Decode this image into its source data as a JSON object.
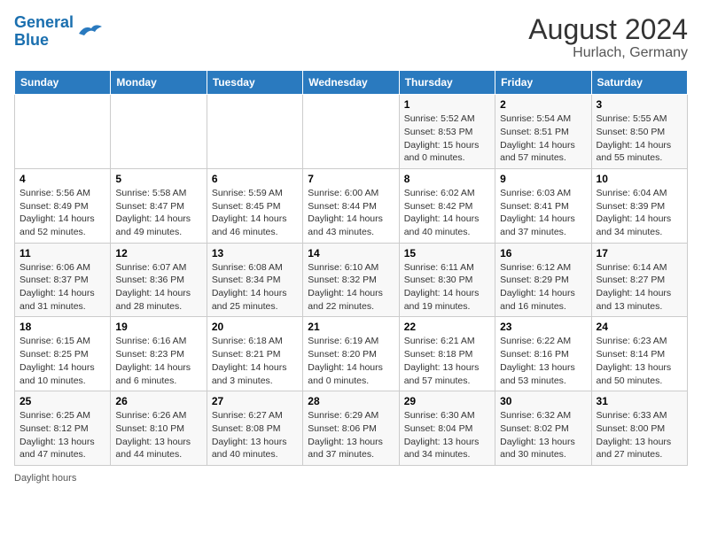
{
  "header": {
    "logo_line1": "General",
    "logo_line2": "Blue",
    "title": "August 2024",
    "subtitle": "Hurlach, Germany"
  },
  "days_of_week": [
    "Sunday",
    "Monday",
    "Tuesday",
    "Wednesday",
    "Thursday",
    "Friday",
    "Saturday"
  ],
  "weeks": [
    [
      {
        "num": "",
        "info": ""
      },
      {
        "num": "",
        "info": ""
      },
      {
        "num": "",
        "info": ""
      },
      {
        "num": "",
        "info": ""
      },
      {
        "num": "1",
        "info": "Sunrise: 5:52 AM\nSunset: 8:53 PM\nDaylight: 15 hours and 0 minutes."
      },
      {
        "num": "2",
        "info": "Sunrise: 5:54 AM\nSunset: 8:51 PM\nDaylight: 14 hours and 57 minutes."
      },
      {
        "num": "3",
        "info": "Sunrise: 5:55 AM\nSunset: 8:50 PM\nDaylight: 14 hours and 55 minutes."
      }
    ],
    [
      {
        "num": "4",
        "info": "Sunrise: 5:56 AM\nSunset: 8:49 PM\nDaylight: 14 hours and 52 minutes."
      },
      {
        "num": "5",
        "info": "Sunrise: 5:58 AM\nSunset: 8:47 PM\nDaylight: 14 hours and 49 minutes."
      },
      {
        "num": "6",
        "info": "Sunrise: 5:59 AM\nSunset: 8:45 PM\nDaylight: 14 hours and 46 minutes."
      },
      {
        "num": "7",
        "info": "Sunrise: 6:00 AM\nSunset: 8:44 PM\nDaylight: 14 hours and 43 minutes."
      },
      {
        "num": "8",
        "info": "Sunrise: 6:02 AM\nSunset: 8:42 PM\nDaylight: 14 hours and 40 minutes."
      },
      {
        "num": "9",
        "info": "Sunrise: 6:03 AM\nSunset: 8:41 PM\nDaylight: 14 hours and 37 minutes."
      },
      {
        "num": "10",
        "info": "Sunrise: 6:04 AM\nSunset: 8:39 PM\nDaylight: 14 hours and 34 minutes."
      }
    ],
    [
      {
        "num": "11",
        "info": "Sunrise: 6:06 AM\nSunset: 8:37 PM\nDaylight: 14 hours and 31 minutes."
      },
      {
        "num": "12",
        "info": "Sunrise: 6:07 AM\nSunset: 8:36 PM\nDaylight: 14 hours and 28 minutes."
      },
      {
        "num": "13",
        "info": "Sunrise: 6:08 AM\nSunset: 8:34 PM\nDaylight: 14 hours and 25 minutes."
      },
      {
        "num": "14",
        "info": "Sunrise: 6:10 AM\nSunset: 8:32 PM\nDaylight: 14 hours and 22 minutes."
      },
      {
        "num": "15",
        "info": "Sunrise: 6:11 AM\nSunset: 8:30 PM\nDaylight: 14 hours and 19 minutes."
      },
      {
        "num": "16",
        "info": "Sunrise: 6:12 AM\nSunset: 8:29 PM\nDaylight: 14 hours and 16 minutes."
      },
      {
        "num": "17",
        "info": "Sunrise: 6:14 AM\nSunset: 8:27 PM\nDaylight: 14 hours and 13 minutes."
      }
    ],
    [
      {
        "num": "18",
        "info": "Sunrise: 6:15 AM\nSunset: 8:25 PM\nDaylight: 14 hours and 10 minutes."
      },
      {
        "num": "19",
        "info": "Sunrise: 6:16 AM\nSunset: 8:23 PM\nDaylight: 14 hours and 6 minutes."
      },
      {
        "num": "20",
        "info": "Sunrise: 6:18 AM\nSunset: 8:21 PM\nDaylight: 14 hours and 3 minutes."
      },
      {
        "num": "21",
        "info": "Sunrise: 6:19 AM\nSunset: 8:20 PM\nDaylight: 14 hours and 0 minutes."
      },
      {
        "num": "22",
        "info": "Sunrise: 6:21 AM\nSunset: 8:18 PM\nDaylight: 13 hours and 57 minutes."
      },
      {
        "num": "23",
        "info": "Sunrise: 6:22 AM\nSunset: 8:16 PM\nDaylight: 13 hours and 53 minutes."
      },
      {
        "num": "24",
        "info": "Sunrise: 6:23 AM\nSunset: 8:14 PM\nDaylight: 13 hours and 50 minutes."
      }
    ],
    [
      {
        "num": "25",
        "info": "Sunrise: 6:25 AM\nSunset: 8:12 PM\nDaylight: 13 hours and 47 minutes."
      },
      {
        "num": "26",
        "info": "Sunrise: 6:26 AM\nSunset: 8:10 PM\nDaylight: 13 hours and 44 minutes."
      },
      {
        "num": "27",
        "info": "Sunrise: 6:27 AM\nSunset: 8:08 PM\nDaylight: 13 hours and 40 minutes."
      },
      {
        "num": "28",
        "info": "Sunrise: 6:29 AM\nSunset: 8:06 PM\nDaylight: 13 hours and 37 minutes."
      },
      {
        "num": "29",
        "info": "Sunrise: 6:30 AM\nSunset: 8:04 PM\nDaylight: 13 hours and 34 minutes."
      },
      {
        "num": "30",
        "info": "Sunrise: 6:32 AM\nSunset: 8:02 PM\nDaylight: 13 hours and 30 minutes."
      },
      {
        "num": "31",
        "info": "Sunrise: 6:33 AM\nSunset: 8:00 PM\nDaylight: 13 hours and 27 minutes."
      }
    ]
  ],
  "footer": {
    "daylight_label": "Daylight hours"
  }
}
